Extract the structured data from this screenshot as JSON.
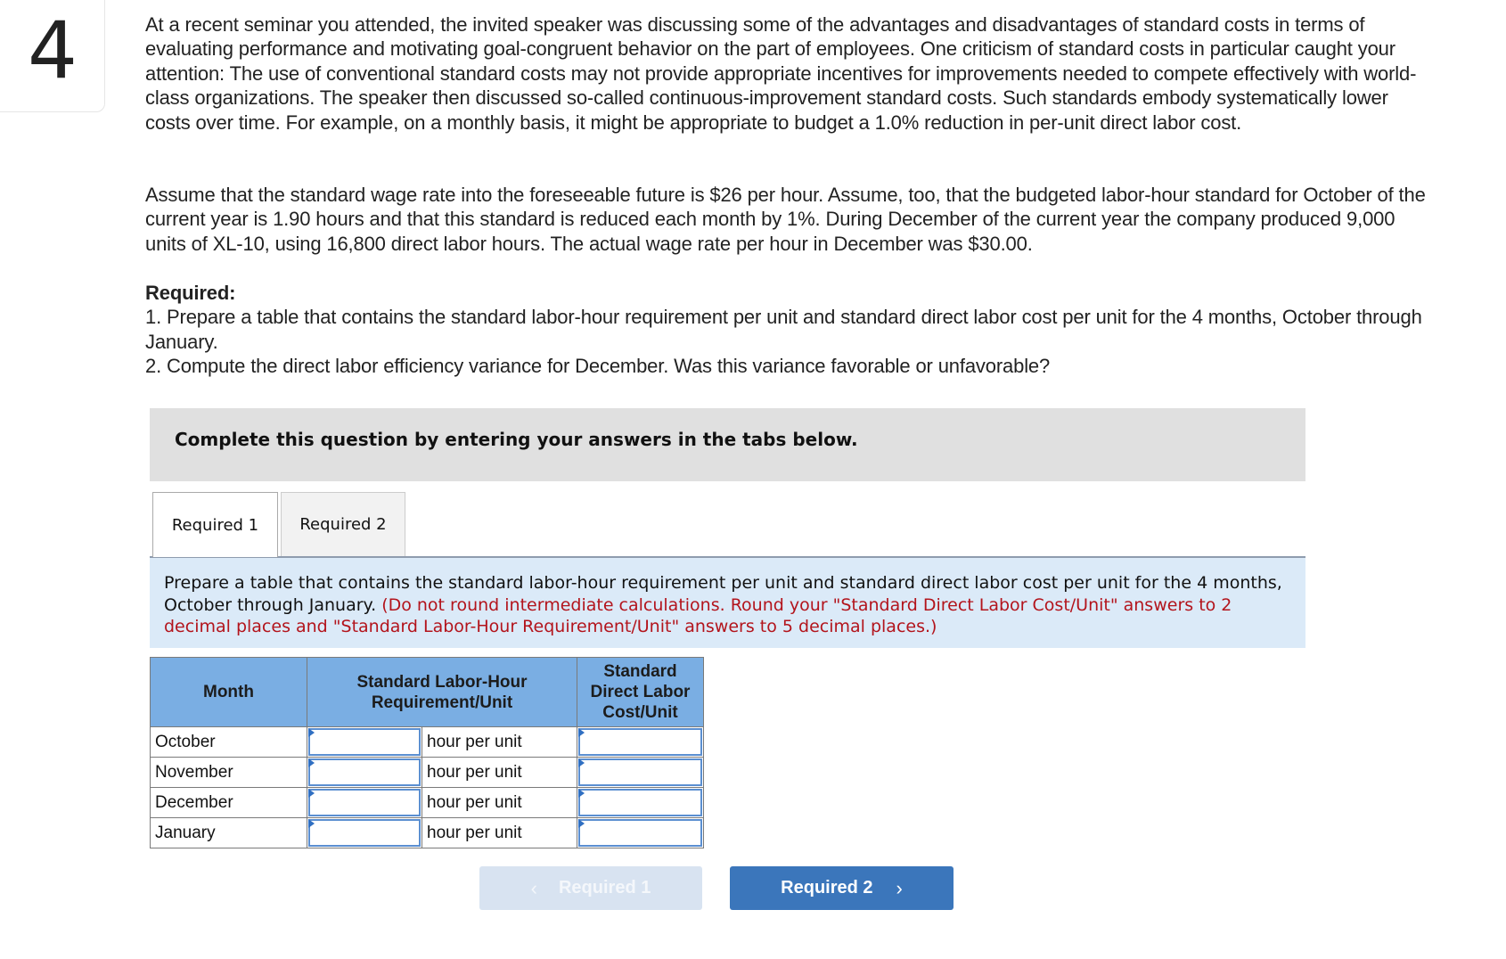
{
  "question": {
    "number": "4",
    "paragraphs": [
      "At a recent seminar you attended, the invited speaker was discussing some of the advantages and disadvantages of standard costs in terms of evaluating performance and motivating goal-congruent behavior on the part of employees. One criticism of standard costs in particular caught your attention: The use of conventional standard costs may not provide appropriate incentives for improvements needed to compete effectively with world-class organizations. The speaker then discussed so-called continuous-improvement standard costs. Such standards embody systematically lower costs over time. For example, on a monthly basis, it might be appropriate to budget a 1.0% reduction in per-unit direct labor cost.",
      "Assume that the standard wage rate into the foreseeable future is $26 per hour. Assume, too, that the budgeted labor-hour standard for October of the current year is 1.90 hours and that this standard is reduced each month by 1%. During December of the current year the company produced 9,000 units of XL-10, using 16,800 direct labor hours. The actual wage rate per hour in December was $30.00."
    ],
    "required_title": "Required:",
    "required_items": [
      "1. Prepare a table that contains the standard labor-hour requirement per unit and standard direct labor cost per unit for the 4 months, October through January.",
      "2. Compute the direct labor efficiency variance for December. Was this variance favorable or unfavorable?"
    ]
  },
  "banner": {
    "text": "Complete this question by entering your answers in the tabs below."
  },
  "tabs": [
    {
      "label": "Required 1",
      "active": true
    },
    {
      "label": "Required 2",
      "active": false
    }
  ],
  "instructions": {
    "text": "Prepare a table that contains the standard labor-hour requirement per unit and standard direct labor cost per unit for the 4 months, October through January.",
    "note": "(Do not round intermediate calculations. Round your \"Standard Direct Labor Cost/Unit\" answers to 2 decimal places and \"Standard Labor-Hour Requirement/Unit\" answers to 5 decimal places.)",
    "note_color": "#b3141c"
  },
  "table": {
    "headers": {
      "month": "Month",
      "labor_hour": "Standard Labor-Hour Requirement/Unit",
      "cost": "Standard Direct Labor Cost/Unit"
    },
    "rows": [
      {
        "month": "October",
        "hours_value": "",
        "unit": "hour per unit",
        "cost_value": ""
      },
      {
        "month": "November",
        "hours_value": "",
        "unit": "hour per unit",
        "cost_value": ""
      },
      {
        "month": "December",
        "hours_value": "",
        "unit": "hour per unit",
        "cost_value": ""
      },
      {
        "month": "January",
        "hours_value": "",
        "unit": "hour per unit",
        "cost_value": ""
      }
    ],
    "header_color": "#7aaee3"
  },
  "nav": {
    "prev_label": "Required 1",
    "prev_icon": "chevron-left-icon",
    "prev_disabled": true,
    "next_label": "Required 2",
    "next_icon": "chevron-right-icon",
    "next_color": "#3b76bb"
  }
}
